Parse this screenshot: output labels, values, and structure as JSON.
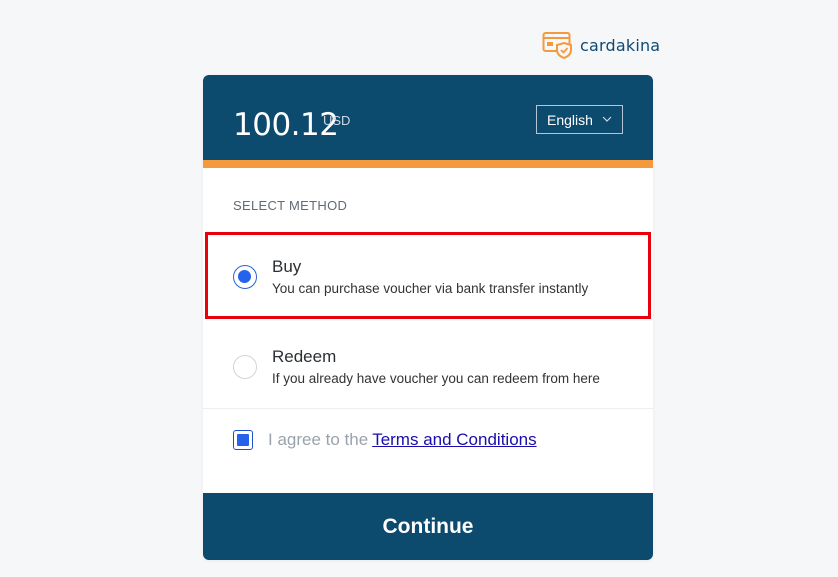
{
  "brand": {
    "name": "cardakina",
    "icon": "card-shield-icon",
    "color": "#f59a3c"
  },
  "header": {
    "amount": "100.12",
    "currency": "USD",
    "language": "English",
    "bg_color": "#0c4a6e",
    "accent_color": "#f59a3c"
  },
  "method": {
    "section_label": "SELECT METHOD",
    "options": [
      {
        "title": "Buy",
        "description": "You can purchase voucher via bank transfer instantly",
        "selected": true
      },
      {
        "title": "Redeem",
        "description": "If you already have voucher you can redeem from here",
        "selected": false
      }
    ]
  },
  "agreement": {
    "text": "I agree to the",
    "link_text": "Terms and Conditions",
    "checked": true
  },
  "actions": {
    "continue_label": "Continue"
  }
}
